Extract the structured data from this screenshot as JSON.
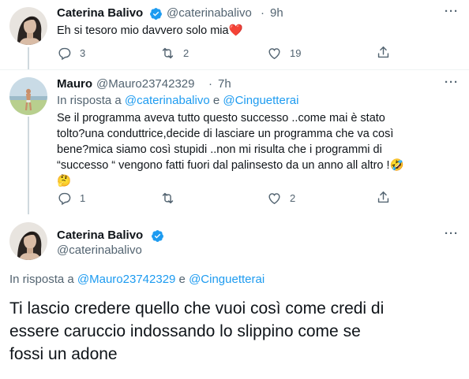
{
  "tweet1": {
    "name": "Caterina Balivo",
    "handle": "@caterinabalivo",
    "time": "9h",
    "text": "Eh si tesoro mio davvero solo mia",
    "heart_emoji": "❤️",
    "replies": "3",
    "retweets": "2",
    "likes": "19"
  },
  "tweet2": {
    "name": "Mauro",
    "handle": "@Mauro23742329",
    "time": "7h",
    "reply_prefix": "In risposta a",
    "reply_user1": "@caterinabalivo",
    "reply_and": "e",
    "reply_user2": "@Cinguetterai",
    "text_line1": "Se il programma aveva tutto questo successo ..come mai è stato",
    "text_line2": "tolto?una conduttrice,decide di lasciare un programma che va così",
    "text_line3": "bene?mica siamo così stupidi ..non mi risulta che i programmi di",
    "text_line4": "“successo “ vengono fatti fuori dal palinsesto da un anno all altro !🤣",
    "text_line5": "🤔",
    "replies": "1",
    "retweets": "",
    "likes": "2"
  },
  "tweet3": {
    "name": "Caterina Balivo",
    "handle": "@caterinabalivo",
    "reply_prefix": "In risposta a",
    "reply_user1": "@Mauro23742329",
    "reply_and": "e",
    "reply_user2": "@Cinguetterai",
    "text_line1": "Ti lascio credere quello che vuoi così come credi di",
    "text_line2": "essere caruccio indossando lo slippino come se",
    "text_line3": "fossi un adone"
  },
  "more_label": "···",
  "colors": {
    "accent": "#1d9bf0",
    "secondary_text": "#536471",
    "heart": "#e0245e"
  },
  "icons": [
    "verified-badge-icon",
    "reply-icon",
    "retweet-icon",
    "like-icon",
    "share-icon",
    "more-icon"
  ]
}
